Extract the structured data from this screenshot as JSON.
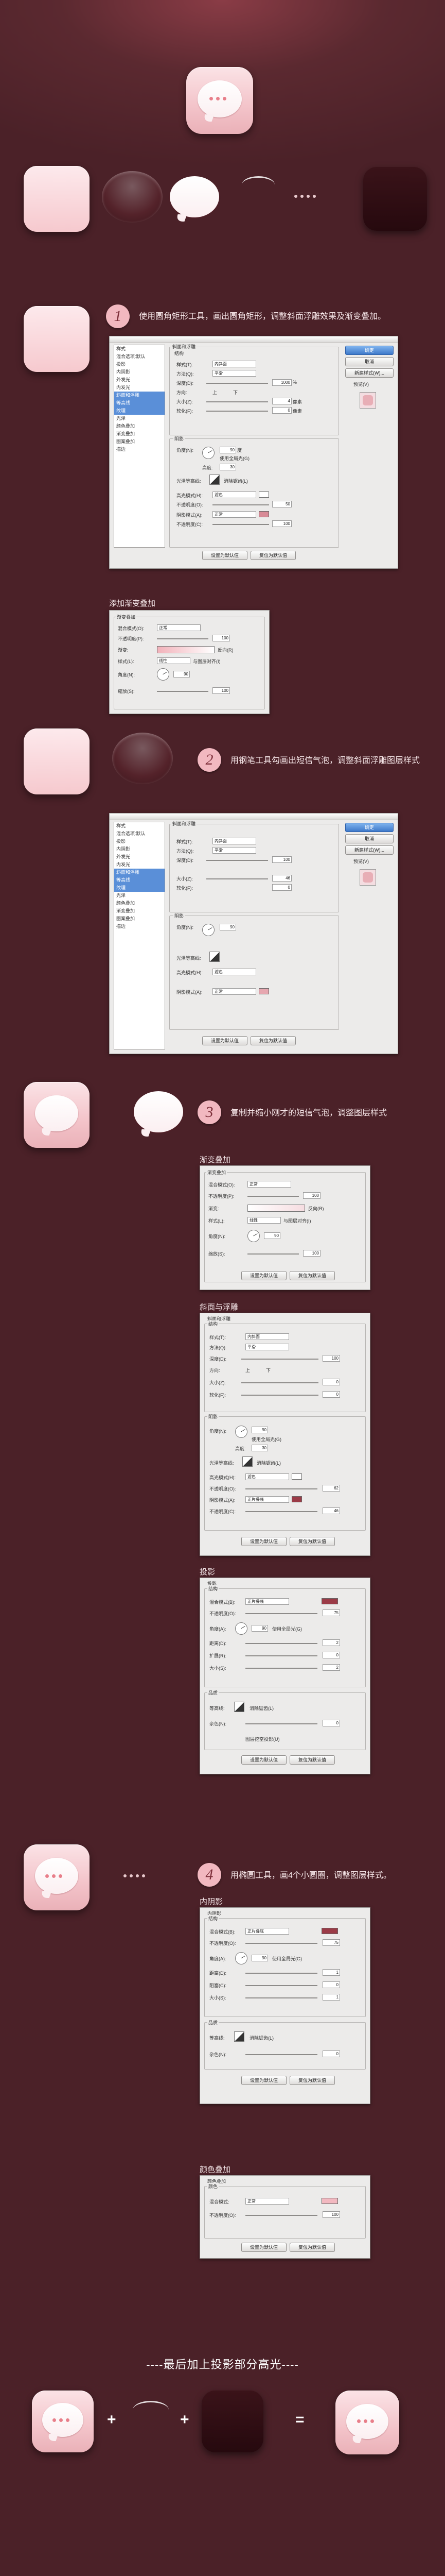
{
  "steps": [
    {
      "num": "1",
      "text": "使用圆角矩形工具，画出圆角矩形，调整斜面浮雕效果及渐变叠加。"
    },
    {
      "num": "2",
      "text": "用钢笔工具勾画出短信气泡，调整斜面浮雕图层样式"
    },
    {
      "num": "3",
      "text": "复制并缩小刚才的短信气泡，调整图层样式"
    },
    {
      "num": "4",
      "text": "用椭圆工具，画4个小圆圈，调整图层样式。"
    }
  ],
  "labels": {
    "gradient_overlay_1": "添加渐变叠加",
    "gradient_overlay_3": "渐变叠加",
    "bevel_emboss_3": "斜面与浮雕",
    "drop_shadow_3": "投影",
    "inner_shadow_4": "内阴影",
    "color_overlay_4": "颜色叠加",
    "final": "----最后加上投影部分高光----"
  },
  "ps": {
    "styles_list": [
      "样式",
      "混合选项:默认",
      "投影",
      "内阴影",
      "外发光",
      "内发光",
      "斜面和浮雕",
      "等高线",
      "纹理",
      "光泽",
      "颜色叠加",
      "渐变叠加",
      "图案叠加",
      "描边"
    ],
    "btn_ok": "确定",
    "btn_cancel": "取消",
    "btn_new_style": "新建样式(W)...",
    "preview_label": "预览(V)",
    "bevel": {
      "group": "斜面和浮雕",
      "structure": "结构",
      "style_label": "样式(T):",
      "style_val": "内斜面",
      "method_label": "方法(Q):",
      "method_val": "平滑",
      "depth_label": "深度(D):",
      "depth_val": "1000",
      "dir_label": "方向:",
      "dir_up": "上",
      "dir_down": "下",
      "size_label": "大小(Z):",
      "size_val": "4",
      "soften_label": "软化(F):",
      "soften_val": "0",
      "shading": "阴影",
      "angle_label": "角度(N):",
      "angle_val": "90",
      "global_light": "使用全局光(G)",
      "altitude_label": "高度:",
      "altitude_val": "30",
      "gloss_label": "光泽等高线:",
      "anti_alias": "消除锯齿(L)",
      "hl_mode_label": "高光模式(H):",
      "hl_mode_val": "滤色",
      "hl_op_label": "不透明度(O):",
      "hl_op_val": "50",
      "sh_mode_label": "阴影模式(A):",
      "sh_mode_val": "正常",
      "sh_op_label": "不透明度(C):",
      "sh_op_val": "100",
      "default_btn": "设置为默认值",
      "reset_btn": "复位为默认值",
      "unit_px": "像素",
      "unit_pct": "%",
      "unit_deg": "度"
    },
    "grad": {
      "group": "渐变叠加",
      "sub": "渐变",
      "mode_label": "混合模式(O):",
      "mode_val": "正常",
      "op_label": "不透明度(P):",
      "op_val": "100",
      "grad_label": "渐变:",
      "reverse": "反向(R)",
      "style_label": "样式(L):",
      "style_val": "线性",
      "align": "与图层对齐(I)",
      "angle_label": "角度(N):",
      "angle_val": "90",
      "scale_label": "缩放(S):",
      "scale_val": "100"
    },
    "bevel2": {
      "depth_val": "100",
      "size_val": "46",
      "soften_val": "0"
    },
    "bevel3": {
      "style_val": "内斜面",
      "method_val": "平滑",
      "depth_val": "100",
      "size_val": "0",
      "soften_val": "0",
      "hl_mode_val": "滤色",
      "sh_mode_val": "正片叠底",
      "hl_op_val": "62",
      "sh_op_val": "46"
    },
    "shadow": {
      "group": "投影",
      "structure": "结构",
      "mode_label": "混合模式(B):",
      "mode_val": "正片叠底",
      "op_label": "不透明度(O):",
      "op_val": "75",
      "angle_label": "角度(A):",
      "angle_val": "90",
      "global_light": "使用全局光(G)",
      "dist_label": "距离(D):",
      "dist_val": "2",
      "spread_label": "扩展(R):",
      "spread_val": "0",
      "size_label": "大小(S):",
      "size_val": "2",
      "quality": "品质",
      "contour_label": "等高线:",
      "anti_alias": "消除锯齿(L)",
      "noise_label": "杂色(N):",
      "noise_val": "0",
      "knockout": "图层挖空投影(U)"
    },
    "inner": {
      "group": "内阴影",
      "structure": "结构",
      "mode_label": "混合模式(B):",
      "mode_val": "正片叠底",
      "op_label": "不透明度(O):",
      "op_val": "75",
      "angle_label": "角度(A):",
      "angle_val": "90",
      "global_light": "使用全局光(G)",
      "dist_label": "距离(D):",
      "dist_val": "1",
      "choke_label": "阻塞(C):",
      "choke_val": "0",
      "size_label": "大小(S):",
      "size_val": "1",
      "quality": "品质",
      "contour_label": "等高线:",
      "anti_alias": "消除锯齿(L)",
      "noise_label": "杂色(N):",
      "noise_val": "0"
    },
    "color": {
      "group": "颜色叠加",
      "sub": "颜色",
      "mode_label": "混合模式:",
      "mode_val": "正常",
      "op_label": "不透明度(O):",
      "op_val": "100"
    }
  },
  "colors": {
    "accent": "#f2b8c0",
    "bg": "#4b2128",
    "dot": "#e87f8a",
    "shadow_swatch": "#9b3b47"
  }
}
